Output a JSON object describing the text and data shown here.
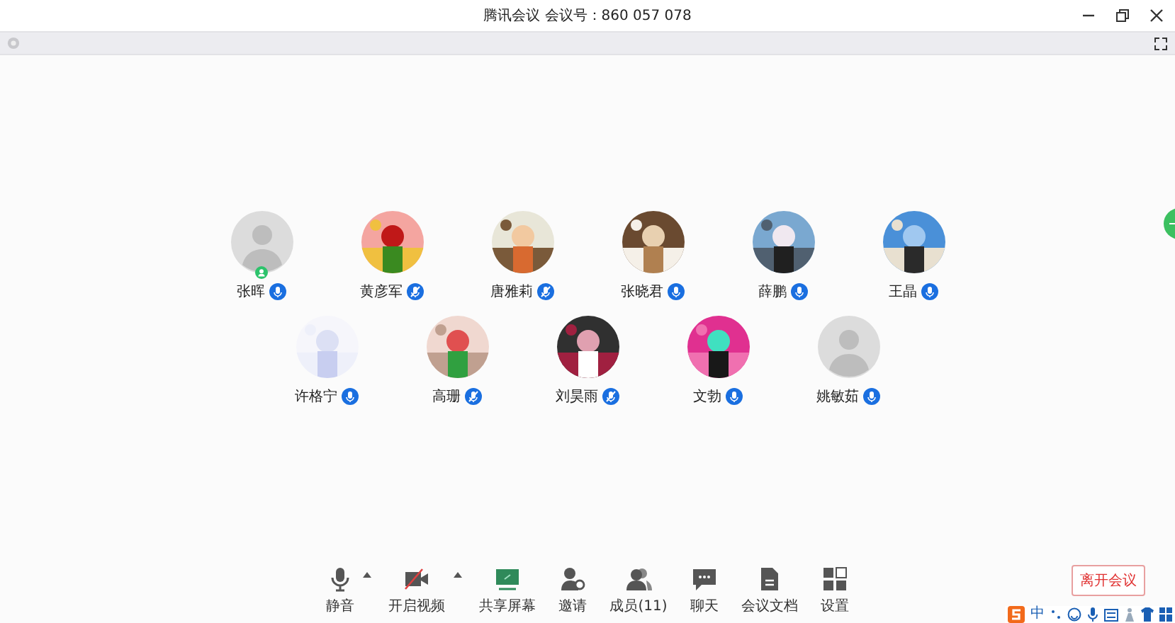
{
  "window": {
    "title": "腾讯会议 会议号：860 057 078"
  },
  "participants": [
    {
      "name": "张晖",
      "photo": false,
      "host": true,
      "muted": false
    },
    {
      "name": "黄彦军",
      "photo": true,
      "host": false,
      "muted": true
    },
    {
      "name": "唐雅莉",
      "photo": true,
      "host": false,
      "muted": true
    },
    {
      "name": "张晓君",
      "photo": true,
      "host": false,
      "muted": false
    },
    {
      "name": "薛鹏",
      "photo": true,
      "host": false,
      "muted": false
    },
    {
      "name": "王晶",
      "photo": true,
      "host": false,
      "muted": false
    },
    {
      "name": "许格宁",
      "photo": true,
      "host": false,
      "muted": false
    },
    {
      "name": "高珊",
      "photo": true,
      "host": false,
      "muted": true
    },
    {
      "name": "刘昊雨",
      "photo": true,
      "host": false,
      "muted": true
    },
    {
      "name": "文勃",
      "photo": true,
      "host": false,
      "muted": false
    },
    {
      "name": "姚敏茹",
      "photo": false,
      "host": false,
      "muted": false
    }
  ],
  "toolbar": [
    {
      "kind": "mic",
      "label": "静音",
      "caret": true
    },
    {
      "kind": "video",
      "label": "开启视频",
      "caret": true
    },
    {
      "kind": "share",
      "label": "共享屏幕",
      "caret": false
    },
    {
      "kind": "invite",
      "label": "邀请",
      "caret": false
    },
    {
      "kind": "members",
      "label": "成员(11)",
      "caret": false
    },
    {
      "kind": "chat",
      "label": "聊天",
      "caret": false
    },
    {
      "kind": "docs",
      "label": "会议文档",
      "caret": false
    },
    {
      "kind": "settings",
      "label": "设置",
      "caret": false
    }
  ],
  "leave_button": "离开会议",
  "ime_bar": {
    "mode": "中"
  }
}
